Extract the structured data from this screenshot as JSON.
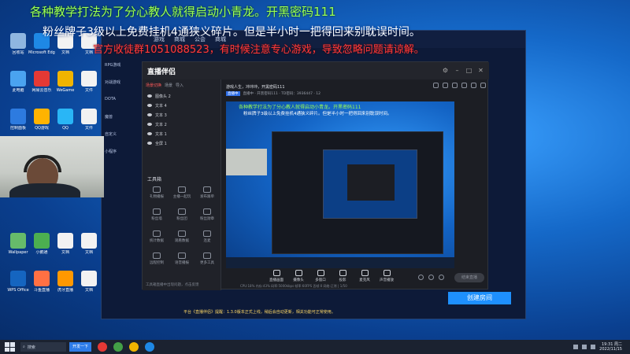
{
  "overlay": {
    "line1": "各种教学打法为了分心教人就得启动小青龙。开黑密码111",
    "line2": "粉丝牌子3级以上免费挂机4通狭义碎片。但是半小时一把得回来别耽误时间。",
    "line3": "官方收徒群1051088523，有时候注意专心游戏，导致忽略问题请谅解。"
  },
  "desktop_icons": [
    {
      "label": "回收站",
      "color": "#8fb6e0"
    },
    {
      "label": "Microsoft Edge",
      "color": "#1e88e5"
    },
    {
      "label": "文档",
      "color": "#f2f2f2"
    },
    {
      "label": "文档",
      "color": "#f2f2f2"
    },
    {
      "label": "此电脑",
      "color": "#4aa3f0"
    },
    {
      "label": "网易云音乐",
      "color": "#e53935"
    },
    {
      "label": "WeGame",
      "color": "#f0b400"
    },
    {
      "label": "文件",
      "color": "#f2f2f2"
    },
    {
      "label": "控制面板",
      "color": "#2d7be0"
    },
    {
      "label": "QQ游戏",
      "color": "#ffb300"
    },
    {
      "label": "QQ",
      "color": "#29b6f6"
    },
    {
      "label": "文件",
      "color": "#f2f2f2"
    },
    {
      "label": "Wallpaper",
      "color": "#66bb6a"
    },
    {
      "label": "小鹅通",
      "color": "#4caf50"
    },
    {
      "label": "文档",
      "color": "#f2f2f2"
    },
    {
      "label": "文档",
      "color": "#f2f2f2"
    },
    {
      "label": "WPS Office",
      "color": "#1565c0"
    },
    {
      "label": "斗鱼直播",
      "color": "#ff7043"
    },
    {
      "label": "虎牙直播",
      "color": "#ff9800"
    },
    {
      "label": "文档",
      "color": "#f2f2f2"
    }
  ],
  "game": {
    "topbar": [
      "游戏",
      "商城",
      "公会",
      "商城"
    ],
    "side": [
      "RPG游戏",
      "对战游戏",
      "DOTA",
      "魔兽",
      "自定义",
      "小程序"
    ],
    "notice": "平台《直播伴侣》提醒：1.3.0版本正式上线，稍后会自动更新，相关功能可正常使用。",
    "button": "创建房间"
  },
  "app": {
    "title": "直播伴侣",
    "tabs": [
      "场景切换",
      "场景",
      "导入"
    ],
    "layers": [
      "图像头 2",
      "文本 4",
      "文本 3",
      "文本 2",
      "文本 1",
      "全屏 1"
    ],
    "tools_title": "工具箱",
    "tools": [
      "礼物播报",
      "主播一起玩",
      "发布跟单",
      "粉丝墙",
      "粉丝团",
      "粉丝勋章",
      "统计数据",
      "观看数据",
      "连麦",
      "远程控制",
      "语音播报",
      "更多工具"
    ],
    "left_footer": "工具箱直播中出现问题，点击反馈",
    "stream_title": "游戏人生，冲冲冲，开黑密码111",
    "stream_tag": "直播中",
    "stream_meta": "直播中 · 开黑密码111 · TD密码：3936447 · 12",
    "controls": [
      "直播画面",
      "摄像头",
      "多窗口",
      "投影",
      "麦克风",
      "声音播放"
    ],
    "stop_label": "结束直播",
    "status": "CPU:18% 内存:43% 码率:5000kbps 帧率:60FPS 丢帧:0 网络:正常 | 1/50",
    "preview": {
      "line1": "各种教学打法为了分心教人就得启动小青龙。开黑密码111",
      "line2": "粉丝牌子3级以上免费挂机4通狭义碎片。但是半小时一把得回来别耽误时间。"
    }
  },
  "taskbar": {
    "search": "搜索",
    "active": "开发一下",
    "time": "19:31 周二",
    "date": "2022/11/15"
  }
}
